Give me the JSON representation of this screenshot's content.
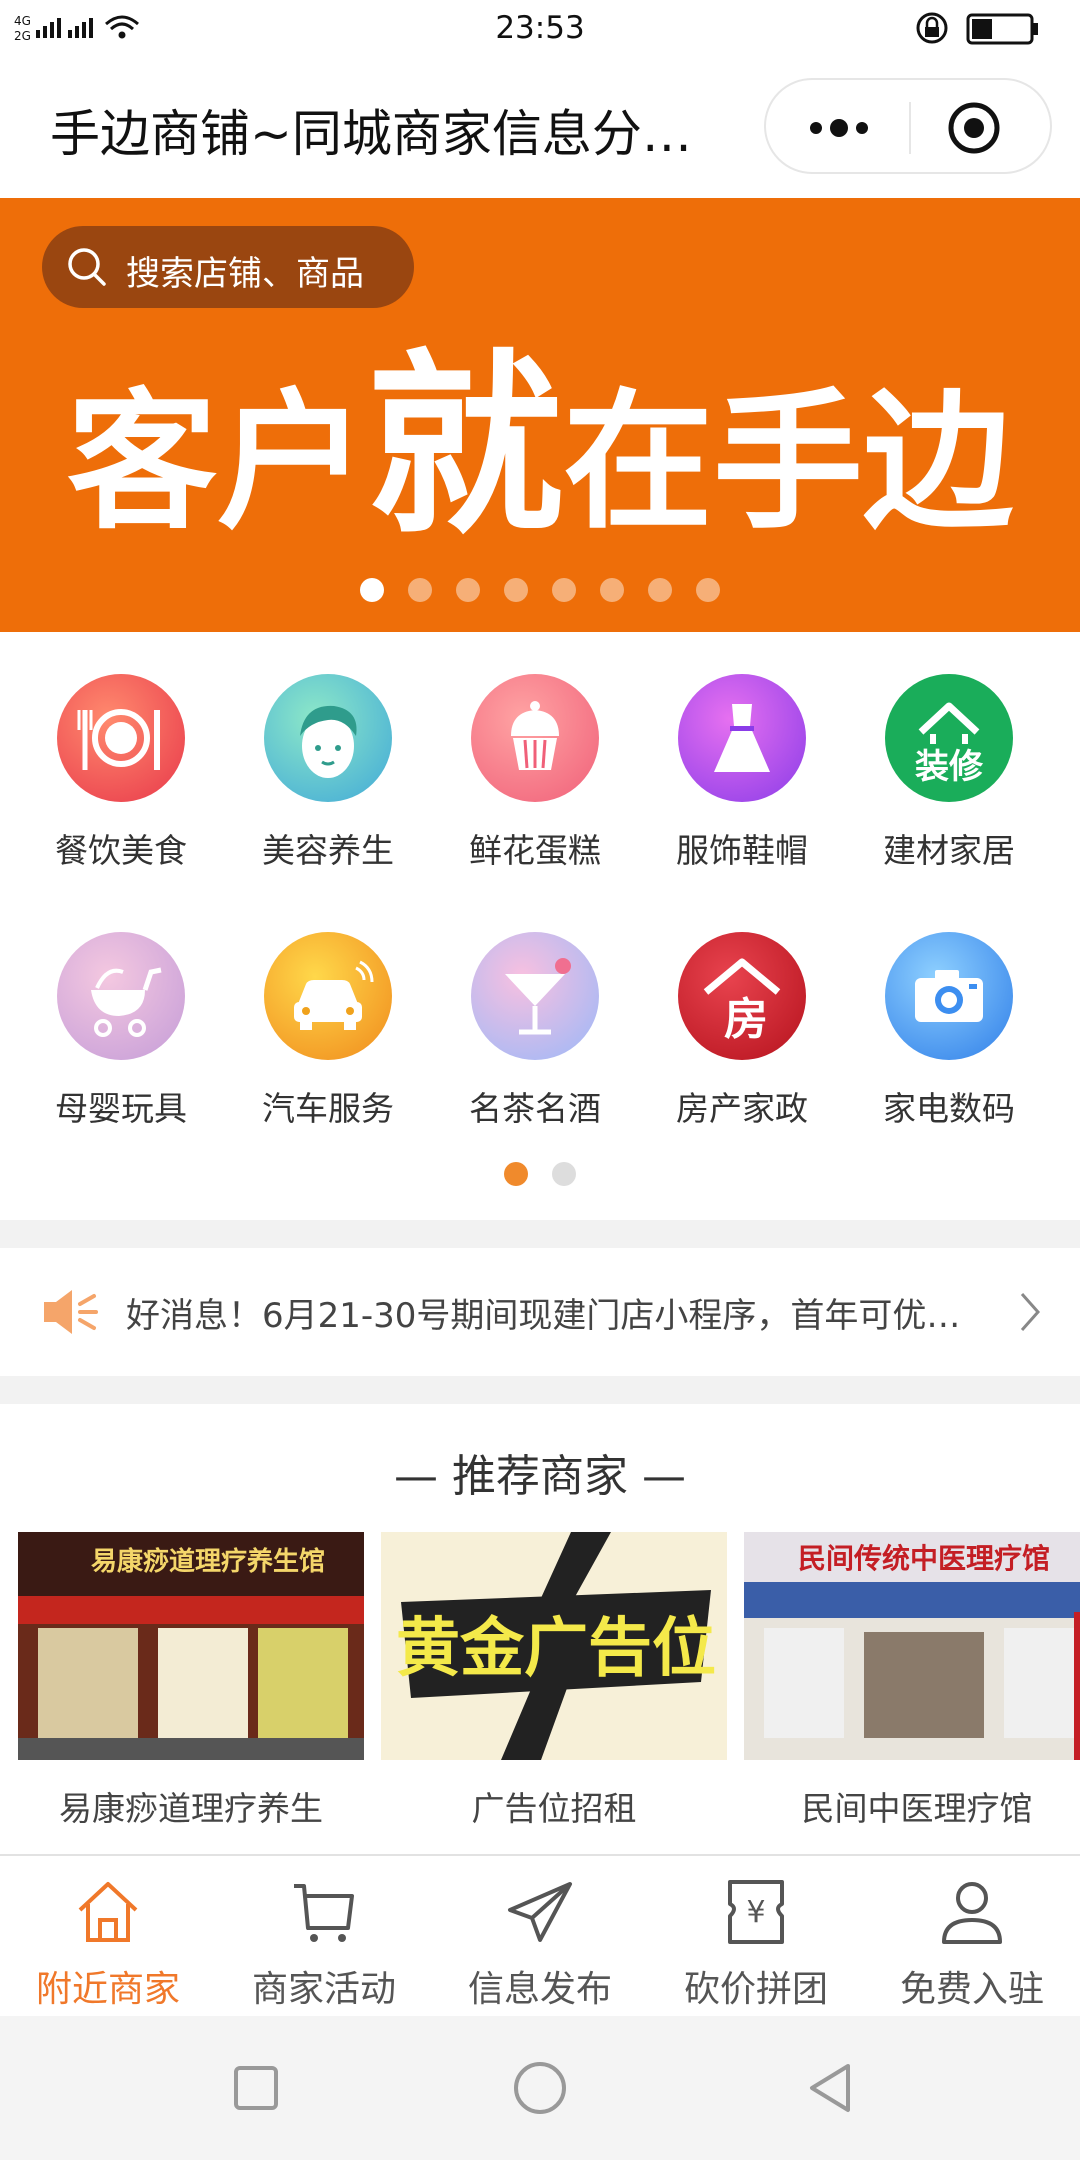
{
  "status_bar": {
    "network": "4G 2G",
    "time": "23:53"
  },
  "title_bar": {
    "title": "手边商铺~同城商家信息分…"
  },
  "banner": {
    "search_placeholder": "搜索店铺、商品",
    "slogan": [
      "客户",
      "就",
      "在手边"
    ],
    "page_count": 8,
    "active_page": 1
  },
  "categories": [
    {
      "label": "餐饮美食",
      "icon": "dining-icon",
      "color": "#f0555a"
    },
    {
      "label": "美容养生",
      "icon": "beauty-icon",
      "color": "#5cc9c0"
    },
    {
      "label": "鲜花蛋糕",
      "icon": "cake-icon",
      "color": "#f46b7c"
    },
    {
      "label": "服饰鞋帽",
      "icon": "dress-icon",
      "color": "#b44fe0"
    },
    {
      "label": "建材家居",
      "icon": "renovation-icon",
      "color": "#1aad5a",
      "icon_text": "装修"
    },
    {
      "label": "母婴玩具",
      "icon": "stroller-icon",
      "color": "#d9a8d8"
    },
    {
      "label": "汽车服务",
      "icon": "car-icon",
      "color": "#f5a623"
    },
    {
      "label": "名茶名酒",
      "icon": "cocktail-icon",
      "color": "#b0a6f0"
    },
    {
      "label": "房产家政",
      "icon": "house-icon",
      "color": "#d0212d",
      "icon_text": "房"
    },
    {
      "label": "家电数码",
      "icon": "camera-icon",
      "color": "#3c8ef0"
    }
  ],
  "category_pages": {
    "count": 2,
    "active": 1
  },
  "notice": {
    "text": "好消息！6月21-30号期间现建门店小程序，首年可优…"
  },
  "recommend": {
    "title": "推荐商家",
    "shops": [
      {
        "name": "易康痧道理疗养生",
        "sign": "易康痧道理疗养生馆"
      },
      {
        "name": "广告位招租",
        "sign": "黄金广告位"
      },
      {
        "name": "民间中医理疗馆",
        "sign": "民间传统中医理疗馆"
      }
    ]
  },
  "tabs": [
    {
      "label": "附近商家",
      "icon": "home-icon",
      "active": true
    },
    {
      "label": "商家活动",
      "icon": "cart-icon",
      "active": false
    },
    {
      "label": "信息发布",
      "icon": "send-icon",
      "active": false
    },
    {
      "label": "砍价拼团",
      "icon": "coupon-icon",
      "active": false
    },
    {
      "label": "免费入驻",
      "icon": "user-icon",
      "active": false
    }
  ],
  "colors": {
    "brand_orange": "#ee6e09",
    "tab_active": "#f0782a"
  }
}
